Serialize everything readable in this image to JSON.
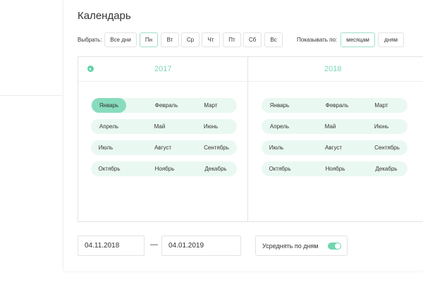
{
  "title": "Календарь",
  "filter": {
    "label": "Выбрать:",
    "days": [
      "Все дни",
      "Пн",
      "Вт",
      "Ср",
      "Чт",
      "Пт",
      "Сб",
      "Вс"
    ],
    "selected_day": "Пн"
  },
  "display": {
    "label": "Показывать по:",
    "options": [
      "месяцам",
      "дням"
    ],
    "selected": "месяцам"
  },
  "years": [
    {
      "year": "2017",
      "months": [
        [
          "Январь",
          "Февраль",
          "Март"
        ],
        [
          "Апрель",
          "Май",
          "Июнь"
        ],
        [
          "Июль",
          "Август",
          "Сентябрь"
        ],
        [
          "Октябрь",
          "Ноябрь",
          "Декабрь"
        ]
      ],
      "selected_month": "Январь"
    },
    {
      "year": "2018",
      "months": [
        [
          "Январь",
          "Февраль",
          "Март"
        ],
        [
          "Апрель",
          "Май",
          "Июнь"
        ],
        [
          "Июль",
          "Август",
          "Сентябрь"
        ],
        [
          "Октябрь",
          "Ноябрь",
          "Декабрь"
        ]
      ]
    }
  ],
  "range": {
    "from": "04.11.2018",
    "separator": "—",
    "to": "04.01.2019"
  },
  "average": {
    "label": "Усреднять по дням",
    "enabled": true
  },
  "colors": {
    "accent": "#5fd3a6",
    "month_row_bg": "#eaf8f2",
    "selected_month_bg": "#88dcbd",
    "year_text": "#7cd9b5"
  },
  "icons": {
    "prev_year": "chevron-left-icon"
  }
}
